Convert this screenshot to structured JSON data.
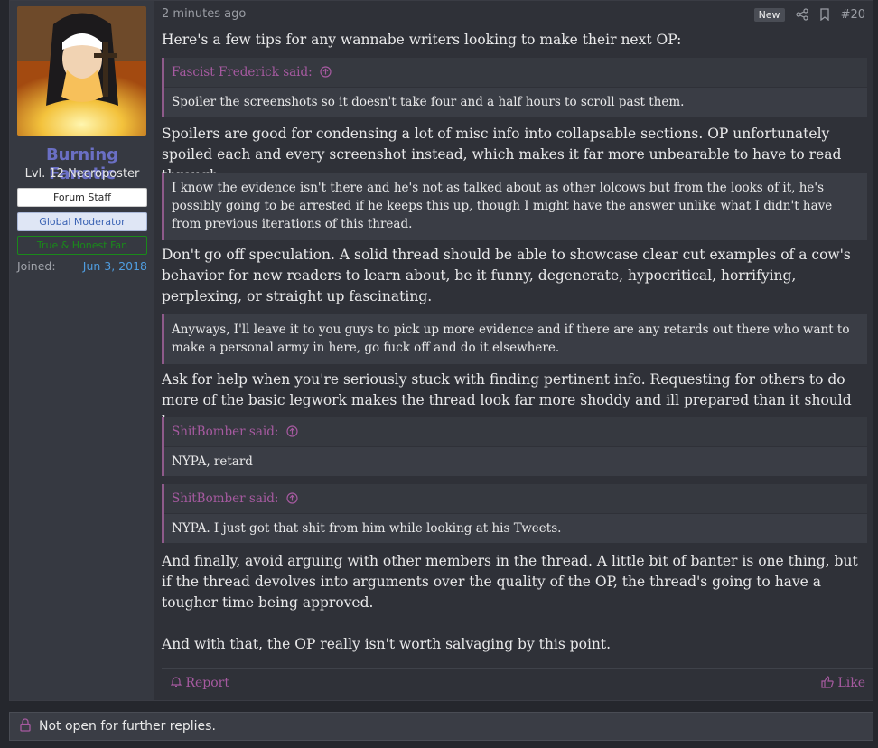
{
  "user": {
    "name": "Burning Fanatic",
    "title": "Lvl. 12 Necroposter",
    "banners": [
      "Forum Staff",
      "Global Moderator",
      "True & Honest Fan"
    ],
    "joined_label": "Joined:",
    "joined_date": "Jun 3, 2018"
  },
  "post": {
    "time": "2 minutes ago",
    "badge": "New",
    "number": "#20",
    "intro": "Here's a few tips for any wannabe writers looking to make their next OP:",
    "quote1_author": "Fascist Frederick said:",
    "quote1_text": "Spoiler the screenshots so it doesn't take four and a half hours to scroll past them.",
    "para1": "Spoilers are good for condensing a lot of misc info into collapsable sections. OP unfortunately spoiled each and every screenshot instead, which makes it far more unbearable to have to read through.",
    "quote2_text": "I know the evidence isn't there and he's not as talked about as other lolcows but from the looks of it, he's possibly going to be arrested if he keeps this up, though I might have the answer unlike what I didn't have from previous iterations of this thread.",
    "para2": "Don't go off speculation. A solid thread should be able to showcase clear cut examples of a cow's behavior for new readers to learn about, be it funny, degenerate, hypocritical, horrifying, perplexing, or straight up fascinating.",
    "quote3_text": "Anyways, I'll leave it to you guys to pick up more evidence and if there are any retards out there who want to make a personal army in here, go fuck off and do it elsewhere.",
    "para3": "Ask for help when you're seriously stuck with finding pertinent info. Requesting for others to do more of the basic legwork makes the thread look far more shoddy and ill prepared than it should be.",
    "quote4_author": "ShitBomber said:",
    "quote4_text": "NYPA, retard",
    "quote5_author": "ShitBomber said:",
    "quote5_text": "NYPA. I just got that shit from him while looking at his Tweets.",
    "para4": "And finally, avoid arguing with other members in the thread. A little bit of banter is one thing, but if the thread devolves into arguments over the quality of the OP, the thread's going to have a tougher time being approved.",
    "para5": "And with that, the OP really isn't worth salvaging by this point.",
    "report_label": "Report",
    "like_label": "Like"
  },
  "closed_notice": "Not open for further replies.",
  "colors": {
    "accent": "#a65aa0",
    "username": "#6a6fc4",
    "link": "#4f9de0"
  }
}
